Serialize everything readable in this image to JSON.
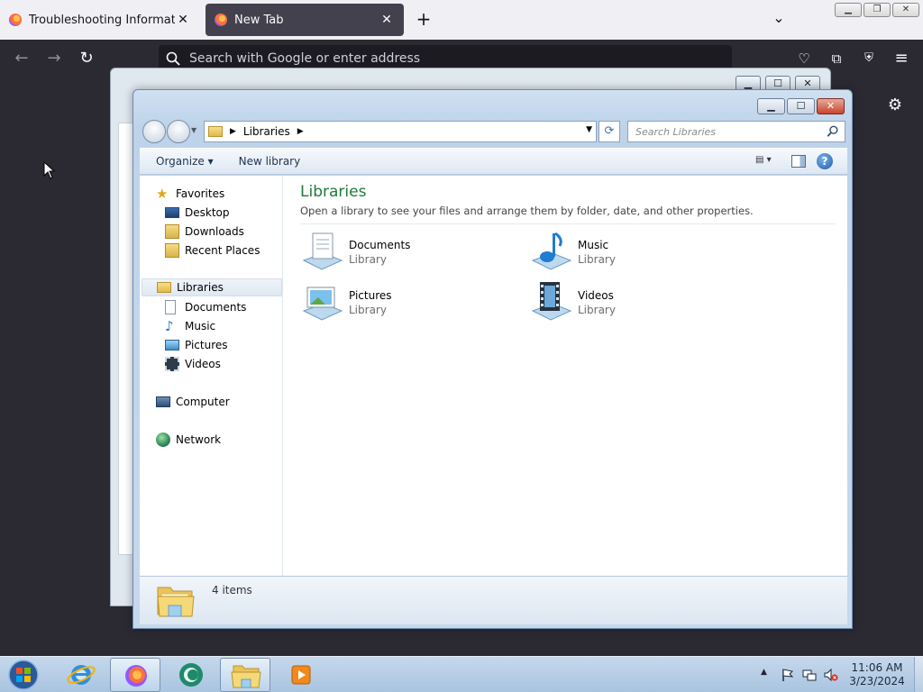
{
  "browser": {
    "tabs": [
      {
        "label": "Troubleshooting Information",
        "active": false
      },
      {
        "label": "New Tab",
        "active": true
      }
    ],
    "urlbar_placeholder": "Search with Google or enter address"
  },
  "explorer": {
    "breadcrumb": "Libraries",
    "search_placeholder": "Search Libraries",
    "toolbar": {
      "organize": "Organize",
      "new_library": "New library"
    },
    "nav": {
      "favorites": "Favorites",
      "favorites_items": [
        "Desktop",
        "Downloads",
        "Recent Places"
      ],
      "libraries": "Libraries",
      "libraries_items": [
        "Documents",
        "Music",
        "Pictures",
        "Videos"
      ],
      "computer": "Computer",
      "network": "Network"
    },
    "content": {
      "title": "Libraries",
      "subtitle": "Open a library to see your files and arrange them by folder, date, and other properties.",
      "items": [
        {
          "name": "Documents",
          "type": "Library",
          "icon": "documents-library-icon"
        },
        {
          "name": "Music",
          "type": "Library",
          "icon": "music-library-icon"
        },
        {
          "name": "Pictures",
          "type": "Library",
          "icon": "pictures-library-icon"
        },
        {
          "name": "Videos",
          "type": "Library",
          "icon": "videos-library-icon"
        }
      ]
    },
    "status": "4 items"
  },
  "taskbar": {
    "clock_time": "11:06 AM",
    "clock_date": "3/23/2024"
  },
  "colors": {
    "firefox_dark": "#2b2a33",
    "library_title_green": "#1e7a37",
    "taskbar_blue": "#b6cde4"
  }
}
